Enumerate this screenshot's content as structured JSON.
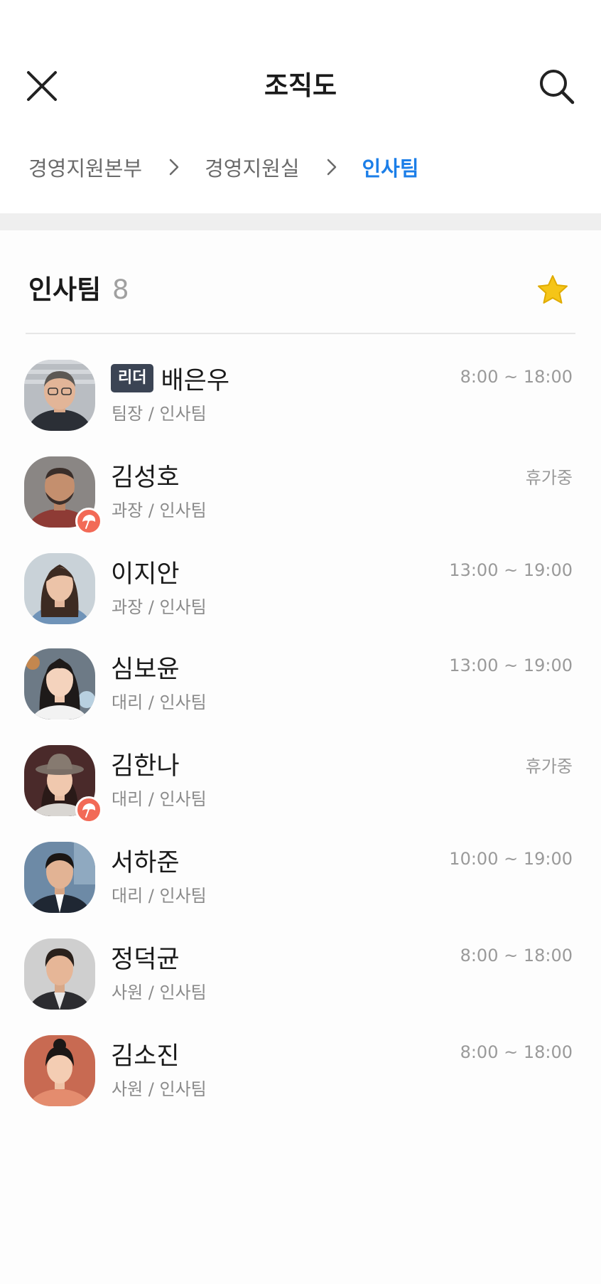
{
  "header": {
    "title": "조직도"
  },
  "breadcrumb": [
    {
      "label": "경영지원본부"
    },
    {
      "label": "경영지원실"
    },
    {
      "label": "인사팀"
    }
  ],
  "team": {
    "name": "인사팀",
    "count": "8"
  },
  "members": [
    {
      "name": "배은우",
      "badge": "리더",
      "role": "팀장 / 인사팀",
      "status": "8:00 ~ 18:00",
      "on_vacation": false
    },
    {
      "name": "김성호",
      "badge": "",
      "role": "과장 / 인사팀",
      "status": "휴가중",
      "on_vacation": true
    },
    {
      "name": "이지안",
      "badge": "",
      "role": "과장 / 인사팀",
      "status": "13:00 ~ 19:00",
      "on_vacation": false
    },
    {
      "name": "심보윤",
      "badge": "",
      "role": "대리 / 인사팀",
      "status": "13:00 ~ 19:00",
      "on_vacation": false
    },
    {
      "name": "김한나",
      "badge": "",
      "role": "대리 / 인사팀",
      "status": "휴가중",
      "on_vacation": true
    },
    {
      "name": "서하준",
      "badge": "",
      "role": "대리 / 인사팀",
      "status": "10:00 ~ 19:00",
      "on_vacation": false
    },
    {
      "name": "정덕균",
      "badge": "",
      "role": "사원 / 인사팀",
      "status": "8:00 ~ 18:00",
      "on_vacation": false
    },
    {
      "name": "김소진",
      "badge": "",
      "role": "사원 / 인사팀",
      "status": "8:00 ~ 18:00",
      "on_vacation": false
    }
  ],
  "colors": {
    "accent": "#1b7ee8",
    "favorite_star": "#f5c518",
    "vacation_badge": "#f26a57",
    "leader_badge": "#3b4454"
  },
  "icons": {
    "close": "close-icon",
    "search": "search-icon",
    "separator": "chevron-right-icon",
    "favorite": "star-icon",
    "vacation": "umbrella-icon"
  }
}
